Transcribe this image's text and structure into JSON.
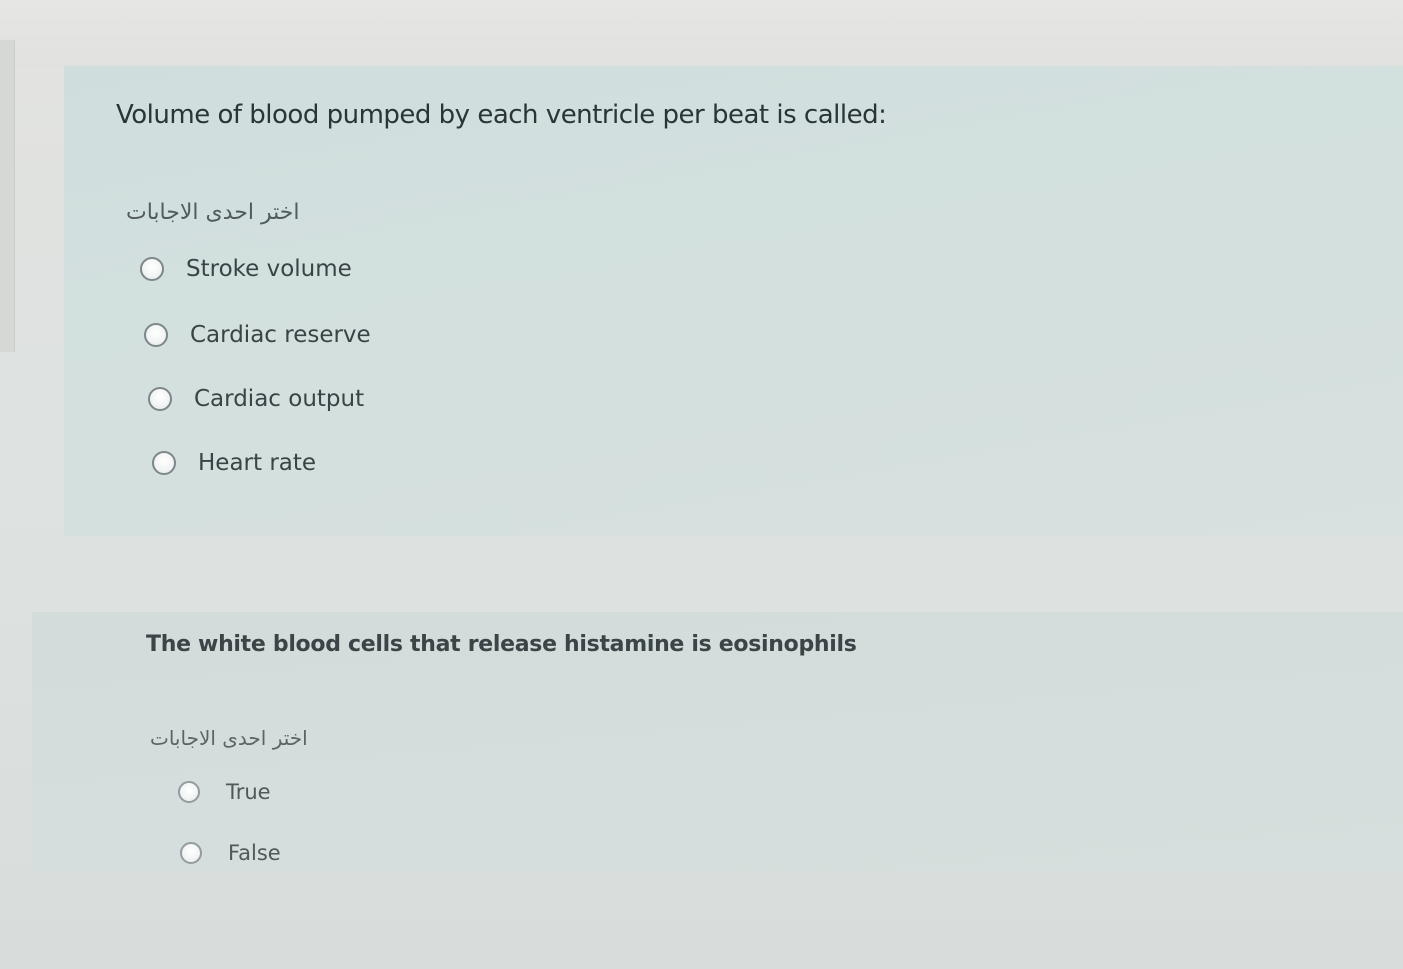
{
  "questions": [
    {
      "text": "Volume of blood pumped by each ventricle per beat is called:",
      "prompt": "اختر احدى الاجابات",
      "options": [
        "Stroke volume",
        "Cardiac reserve",
        "Cardiac output",
        "Heart rate"
      ]
    },
    {
      "text": "The white blood cells that release histamine is eosinophils",
      "prompt": "اختر احدى الاجابات",
      "options": [
        "True",
        "False"
      ]
    }
  ]
}
